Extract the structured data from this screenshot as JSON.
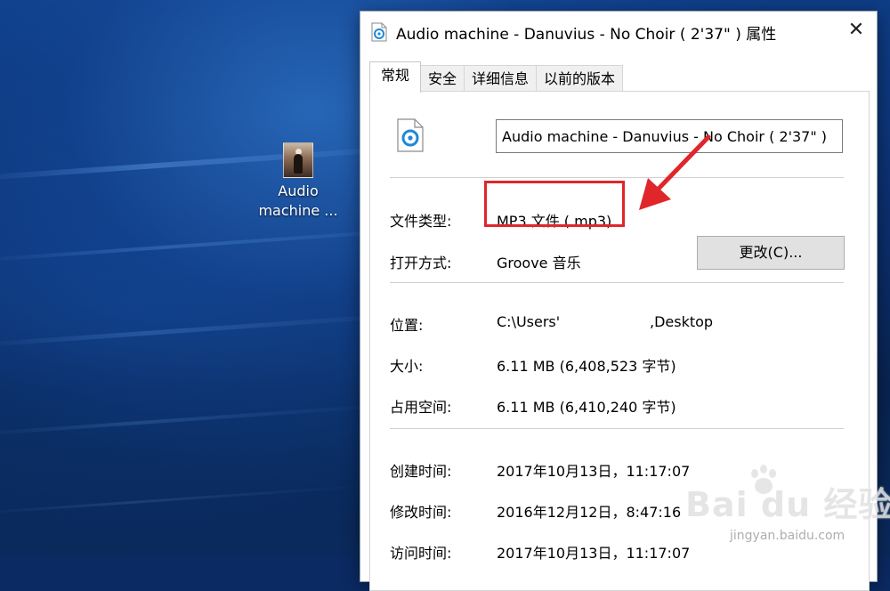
{
  "desktop": {
    "icon_label_line1": "Audio",
    "icon_label_line2": "machine ..."
  },
  "dialog": {
    "title": "Audio machine - Danuvius - No Choir ( 2'37\" ) 属性",
    "close_glyph": "✕",
    "tabs": [
      {
        "label": "常规",
        "active": true
      },
      {
        "label": "安全",
        "active": false
      },
      {
        "label": "详细信息",
        "active": false
      },
      {
        "label": "以前的版本",
        "active": false
      }
    ],
    "file_name": "Audio machine - Danuvius - No Choir ( 2'37\" )",
    "file_type_label": "文件类型:",
    "file_type_value": "MP3 文件 (.mp3)",
    "open_with_label": "打开方式:",
    "open_with_value": "Groove 音乐",
    "change_button": "更改(C)...",
    "location_label": "位置:",
    "location_value_prefix": "C:\\Users'",
    "location_value_suffix": ",Desktop",
    "size_label": "大小:",
    "size_value": "6.11 MB (6,408,523 字节)",
    "disk_size_label": "占用空间:",
    "disk_size_value": "6.11 MB (6,410,240 字节)",
    "created_label": "创建时间:",
    "created_value": "2017年10月13日，11:17:07",
    "modified_label": "修改时间:",
    "modified_value": "2016年12月12日，8:47:16",
    "accessed_label": "访问时间:",
    "accessed_value": "2017年10月13日，11:17:07"
  },
  "watermark": {
    "main": "Bai du 经验",
    "sub": "jingyan.baidu.com"
  },
  "colors": {
    "annotation_red": "#e0262a",
    "icon_blue": "#1e88d8"
  },
  "icons": {
    "file": "groove-music-file-icon",
    "close": "close-icon"
  }
}
